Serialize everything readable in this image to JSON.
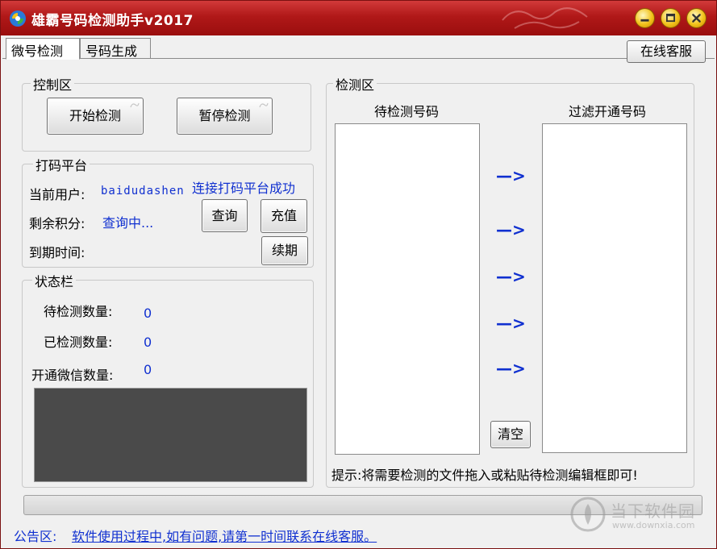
{
  "window": {
    "title": "雄霸号码检测助手v2017",
    "colors": {
      "titlebar": "#b01818",
      "accent_text": "#1030d0",
      "window_button": "#f2c21a"
    }
  },
  "tabs": [
    {
      "label": "微号检测",
      "active": true
    },
    {
      "label": "号码生成",
      "active": false
    }
  ],
  "online_service_button": "在线客服",
  "control_area": {
    "title": "控制区",
    "start_button": "开始检测",
    "pause_button": "暂停检测"
  },
  "captcha_platform": {
    "title": "打码平台",
    "user_label": "当前用户:",
    "user_value": "baidudashen",
    "connect_status": "连接打码平台成功",
    "points_label": "剩余积分:",
    "points_value": "查询中...",
    "query_button": "查询",
    "recharge_button": "充值",
    "expire_label": "到期时间:",
    "renew_button": "续期"
  },
  "status_bar": {
    "title": "状态栏",
    "pending_label": "待检测数量:",
    "pending_value": "0",
    "checked_label": "已检测数量:",
    "checked_value": "0",
    "wechat_label": "开通微信数量:",
    "wechat_value": "0"
  },
  "detect_area": {
    "title": "检测区",
    "pending_header": "待检测号码",
    "filtered_header": "过滤开通号码",
    "arrows": [
      "—>",
      "—>",
      "—>",
      "—>",
      "—>"
    ],
    "clear_button": "清空",
    "hint": "提示:将需要检测的文件拖入或粘贴待检测编辑框即可!"
  },
  "progress": {
    "value": 0
  },
  "notice": {
    "label": "公告区:",
    "text": "软件使用过程中,如有问题,请第一时间联系在线客服。"
  },
  "watermark": {
    "title": "当下软件园",
    "url": "www.downxia.com"
  },
  "icons": [
    "app-icon",
    "minimize-icon",
    "maximize-icon",
    "close-icon",
    "downxia-logo-icon"
  ]
}
